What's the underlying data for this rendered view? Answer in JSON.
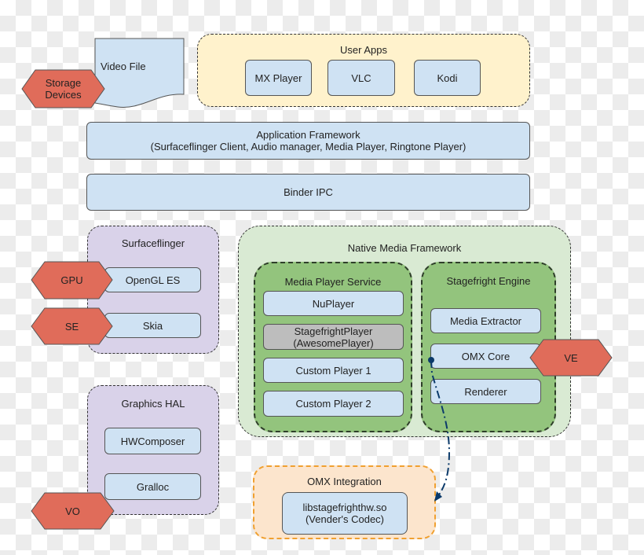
{
  "storage": {
    "label_line1": "Storage",
    "label_line2": "Devices"
  },
  "video_file": {
    "label": "Video File"
  },
  "user_apps": {
    "title": "User Apps",
    "apps": [
      "MX Player",
      "VLC",
      "Kodi"
    ]
  },
  "app_framework": {
    "line1": "Application Framework",
    "line2": "(Surfaceflinger Client, Audio manager, Media Player, Ringtone Player)"
  },
  "binder": {
    "label": "Binder IPC"
  },
  "surfaceflinger": {
    "title": "Surfaceflinger",
    "items": [
      "OpenGL ES",
      "Skia"
    ]
  },
  "graphics_hal": {
    "title": "Graphics HAL",
    "items": [
      "HWComposer",
      "Gralloc"
    ]
  },
  "hexes": {
    "gpu": "GPU",
    "se": "SE",
    "vo": "VO",
    "ve": "VE"
  },
  "native_media": {
    "title": "Native Media Framework",
    "media_player_service": {
      "title": "Media Player Service",
      "items": [
        "NuPlayer",
        "StagefrightPlayer",
        "(AwesomePlayer)",
        "Custom Player 1",
        "Custom Player 2"
      ]
    },
    "stagefright_engine": {
      "title": "Stagefright Engine",
      "items": [
        "Media Extractor",
        "OMX Core",
        "Renderer"
      ]
    }
  },
  "omx_integration": {
    "title": "OMX Integration",
    "lib_line1": "libstagefrighthw.so",
    "lib_line2": "(Vender's Codec)"
  },
  "colors": {
    "blue_box": "#cfe2f3",
    "user_apps": "#fff2cc",
    "purple": "#d9d2e9",
    "native": "#d9ead3",
    "green": "#93c47d",
    "orange": "#fce5cd",
    "hex": "#e06c5a",
    "gray": "#bdbdbd",
    "arrow": "#0b3a6a"
  }
}
